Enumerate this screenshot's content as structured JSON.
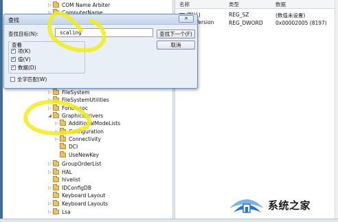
{
  "tree": {
    "items_top": [
      {
        "label": "COM Name Arbiter"
      },
      {
        "label": "ComputerName"
      }
    ],
    "items": [
      {
        "label": "FileSystem"
      },
      {
        "label": "FileSystemUtilities"
      },
      {
        "label": "FontAssoc"
      },
      {
        "label": "GraphicsDrivers"
      },
      {
        "label": "AdditionalModeLists"
      },
      {
        "label": "Configuration"
      },
      {
        "label": "Connectivity"
      },
      {
        "label": "DCI"
      },
      {
        "label": "UseNewKey"
      },
      {
        "label": "GroupOrderList"
      },
      {
        "label": "HAL"
      },
      {
        "label": "hivelist"
      },
      {
        "label": "IDConfigDB"
      },
      {
        "label": "Keyboard Layout"
      },
      {
        "label": "Keyboard Layouts"
      },
      {
        "label": "Lsa"
      }
    ]
  },
  "values": {
    "columns": {
      "name": "名称",
      "type": "类型",
      "data": "数据"
    },
    "rows": [
      {
        "name": "(默认)",
        "type": "REG_SZ",
        "data": "(数值未设置)"
      },
      {
        "name": "ntrlVersion",
        "type": "REG_DWORD",
        "data": "0x00002005 (8197)"
      }
    ]
  },
  "find_dialog": {
    "title": "查找",
    "close_label": "✕",
    "find_label": "查找目标(N):",
    "find_value": "scaling",
    "find_next_label": "查找下一个(F)",
    "cancel_label": "取消",
    "group_title": "查看",
    "options": [
      {
        "label": "项(K)",
        "checked": true
      },
      {
        "label": "值(V)",
        "checked": true
      },
      {
        "label": "数据(D)",
        "checked": true
      }
    ],
    "match_whole": {
      "label": "全字匹配(W)",
      "checked": false
    }
  },
  "watermark": {
    "text": "系统之家",
    "colors": {
      "primary": "#2a73c9",
      "light": "#7fb3e6"
    }
  },
  "colors": {
    "window_frame": "#3e6e97",
    "folder": "#e8c26a",
    "dialog_bg": "#e9eff7"
  }
}
